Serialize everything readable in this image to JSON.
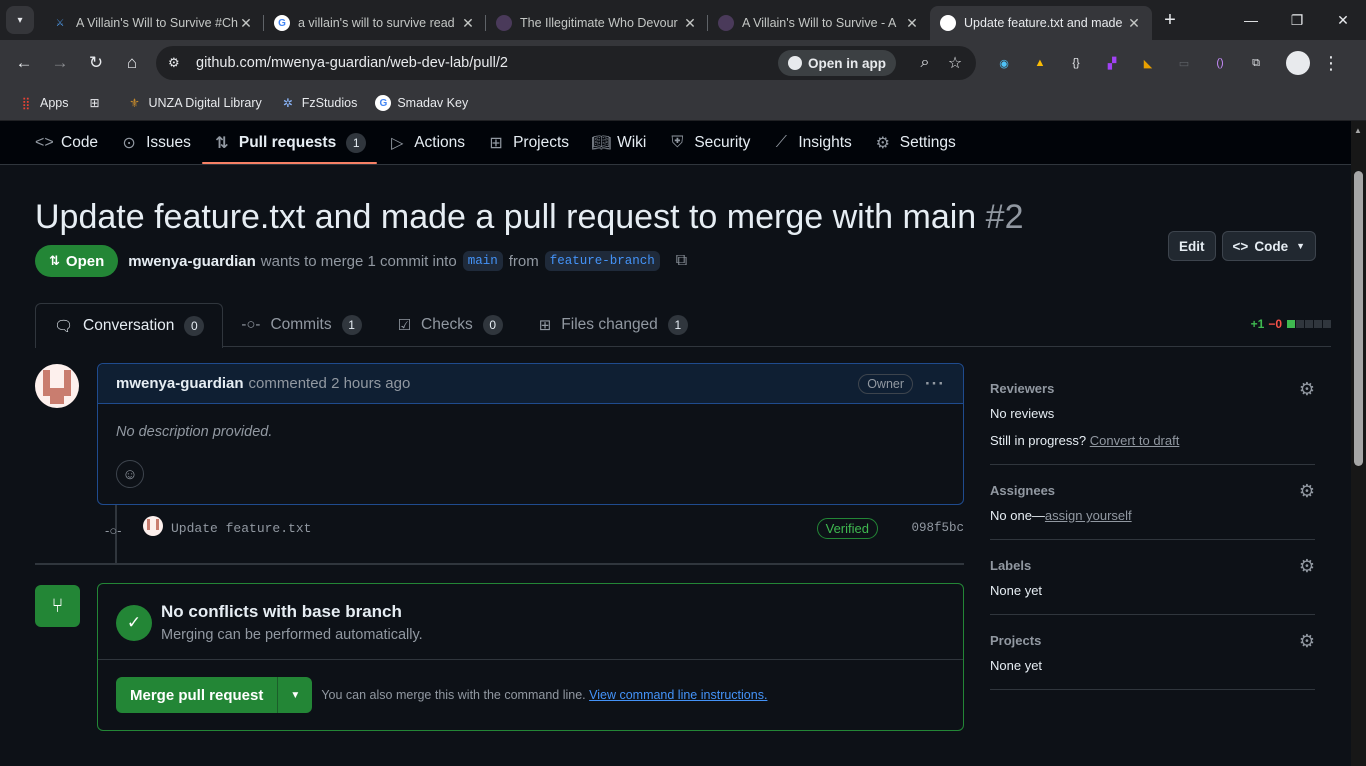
{
  "browser": {
    "tabs": [
      {
        "title": "A Villain's Will to Survive #Ch",
        "fav_color": "#4a90d9",
        "fav_glyph": "⚔"
      },
      {
        "title": "a villain's will to survive read",
        "fav_color": "#ffffff",
        "fav_glyph": "G"
      },
      {
        "title": "The Illegitimate Who Devour",
        "fav_color": "#4a3a5a",
        "fav_glyph": "●"
      },
      {
        "title": "A Villain's Will to Survive - A",
        "fav_color": "#4a3a5a",
        "fav_glyph": "●"
      },
      {
        "title": "Update feature.txt and made",
        "fav_color": "#ffffff",
        "fav_glyph": "●"
      }
    ],
    "url": "github.com/mwenya-guardian/web-dev-lab/pull/2",
    "open_in_app": "Open in app",
    "bookmarks": [
      {
        "label": "Apps",
        "icon": "apps-icon"
      },
      {
        "label": "",
        "icon": "grid-icon"
      },
      {
        "label": "UNZA Digital Library",
        "icon": "library-icon"
      },
      {
        "label": "FzStudios",
        "icon": "star-icon"
      },
      {
        "label": "Smadav Key",
        "icon": "google-icon"
      }
    ]
  },
  "repo_nav": [
    {
      "label": "Code",
      "icon": "code-icon",
      "active": false
    },
    {
      "label": "Issues",
      "icon": "issue-icon",
      "active": false
    },
    {
      "label": "Pull requests",
      "icon": "pull-request-icon",
      "active": true,
      "count": "1"
    },
    {
      "label": "Actions",
      "icon": "play-icon",
      "active": false
    },
    {
      "label": "Projects",
      "icon": "table-icon",
      "active": false
    },
    {
      "label": "Wiki",
      "icon": "book-icon",
      "active": false
    },
    {
      "label": "Security",
      "icon": "shield-icon",
      "active": false
    },
    {
      "label": "Insights",
      "icon": "graph-icon",
      "active": false
    },
    {
      "label": "Settings",
      "icon": "gear-icon",
      "active": false
    }
  ],
  "pr": {
    "title": "Update feature.txt and made a pull request to merge with main",
    "number": "#2",
    "edit_label": "Edit",
    "code_label": "Code",
    "state": "Open",
    "author": "mwenya-guardian",
    "meta_text": "wants to merge 1 commit into",
    "base_branch": "main",
    "from_text": "from",
    "head_branch": "feature-branch"
  },
  "pr_tabs": [
    {
      "label": "Conversation",
      "count": "0",
      "icon": "comment-icon"
    },
    {
      "label": "Commits",
      "count": "1",
      "icon": "commit-icon"
    },
    {
      "label": "Checks",
      "count": "0",
      "icon": "checklist-icon"
    },
    {
      "label": "Files changed",
      "count": "1",
      "icon": "file-diff-icon"
    }
  ],
  "diffstat": {
    "additions": "+1",
    "deletions": "−0"
  },
  "comment": {
    "author": "mwenya-guardian",
    "action": "commented",
    "time": "2 hours ago",
    "role": "Owner",
    "body": "No description provided."
  },
  "commit": {
    "message": "Update feature.txt",
    "status": "Verified",
    "sha": "098f5bc"
  },
  "merge": {
    "title": "No conflicts with base branch",
    "subtitle": "Merging can be performed automatically.",
    "button": "Merge pull request",
    "note": "You can also merge this with the command line.",
    "link": "View command line instructions."
  },
  "sidebar": {
    "reviewers": {
      "title": "Reviewers",
      "value": "No reviews",
      "progress_text": "Still in progress?",
      "progress_link": "Convert to draft"
    },
    "assignees": {
      "title": "Assignees",
      "value": "No one—",
      "link": "assign yourself"
    },
    "labels": {
      "title": "Labels",
      "value": "None yet"
    },
    "projects": {
      "title": "Projects",
      "value": "None yet"
    }
  },
  "colors": {
    "accent_green": "#238636",
    "link_blue": "#4493f8",
    "nav_underline": "#f78166"
  }
}
